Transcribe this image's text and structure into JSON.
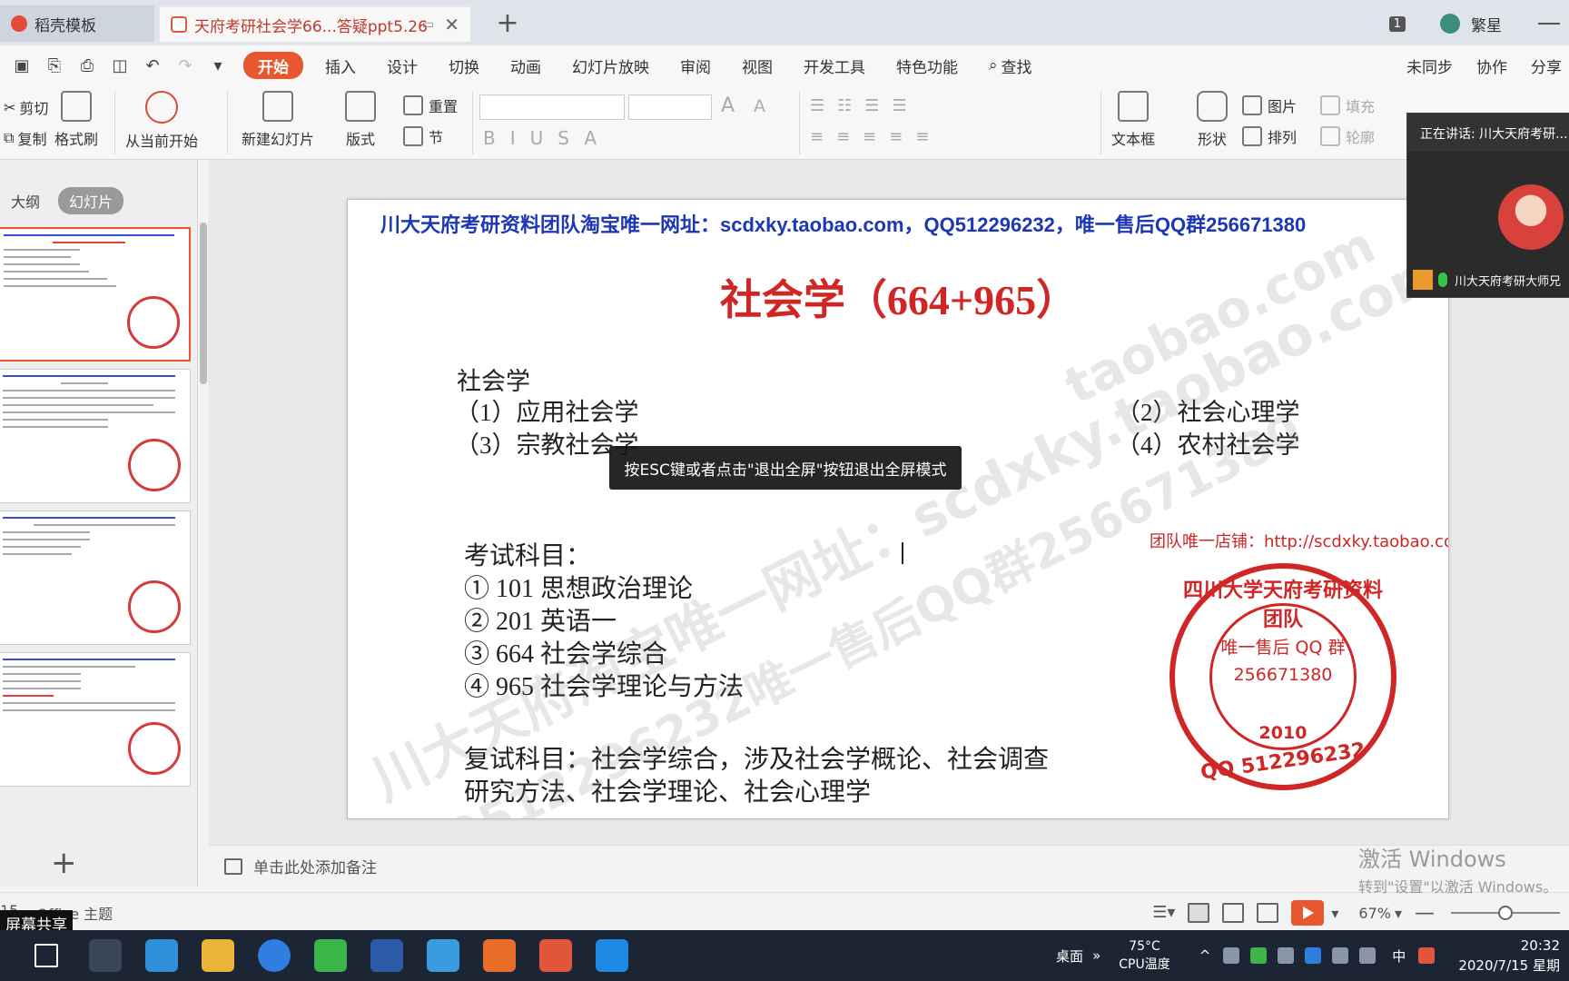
{
  "tabs": [
    {
      "label": "稻壳模板"
    },
    {
      "label": "天府考研社会学66...答疑ppt5.26"
    }
  ],
  "titlebar": {
    "badge": "1",
    "user": "繁星"
  },
  "menu": {
    "items": [
      "开始",
      "插入",
      "设计",
      "切换",
      "动画",
      "幻灯片放映",
      "审阅",
      "视图",
      "开发工具",
      "特色功能",
      "查找"
    ],
    "sync": "未同步",
    "collab": "协作",
    "share": "分享"
  },
  "ribbon": {
    "cut": "剪切",
    "copy": "复制",
    "format_painter": "格式刷",
    "from_current": "从当前开始",
    "new_slide": "新建幻灯片",
    "layout": "版式",
    "reset": "重置",
    "section": "节",
    "textbox": "文本框",
    "shape": "形状",
    "picture": "图片",
    "arrange": "排列",
    "fill": "填充",
    "outline": "轮廓",
    "find": "查找"
  },
  "leftpanel": {
    "outline_tab": "大纲",
    "slides_tab": "幻灯片"
  },
  "slide": {
    "header": "川大天府考研资料团队淘宝唯一网址：scdxky.taobao.com，QQ512296232，唯一售后QQ群256671380",
    "title": "社会学（664+965）",
    "section": "社会学",
    "items": [
      "（1）应用社会学",
      "（2）社会心理学",
      "（3）宗教社会学",
      "（4）农村社会学"
    ],
    "exam_label": "考试科目：",
    "exam_items": [
      "① 101 思想政治理论",
      "② 201 英语一",
      "③ 664 社会学综合",
      "④ 965 社会学理论与方法"
    ],
    "retest_line1": "复试科目：社会学综合，涉及社会学概论、社会调查",
    "retest_line2": "研究方法、社会学理论、社会心理学",
    "stamp": {
      "url": "团队唯一店铺：http://scdxky.taobao.com",
      "arc": "四川大学天府考研资料团队",
      "group": "唯一售后 QQ 群",
      "number": "256671380",
      "year": "2010",
      "qq": "QQ 512296232"
    },
    "watermarks": [
      "川大天府淘宝唯一网址：scdxky.taobao.com",
      "QQ512296232唯一售后QQ群256671380",
      "taobao.com"
    ]
  },
  "toast": "按ESC键或者点击\"退出全屏\"按钮退出全屏模式",
  "notes_placeholder": "单击此处添加备注",
  "status": {
    "slide_count": "15",
    "theme": "Office 主题",
    "zoom": "67%",
    "share_label": "屏幕共享"
  },
  "activate": {
    "line1": "激活 Windows",
    "line2": "转到\"设置\"以激活 Windows。"
  },
  "speaker": {
    "head": "正在讲话: 川大天府考研...",
    "name": "川大天府考研大师兄"
  },
  "tray": {
    "desktop": "桌面",
    "temp": "75°C",
    "cpu": "CPU温度",
    "ime": "中",
    "time": "20:32",
    "date": "2020/7/15 星期"
  }
}
